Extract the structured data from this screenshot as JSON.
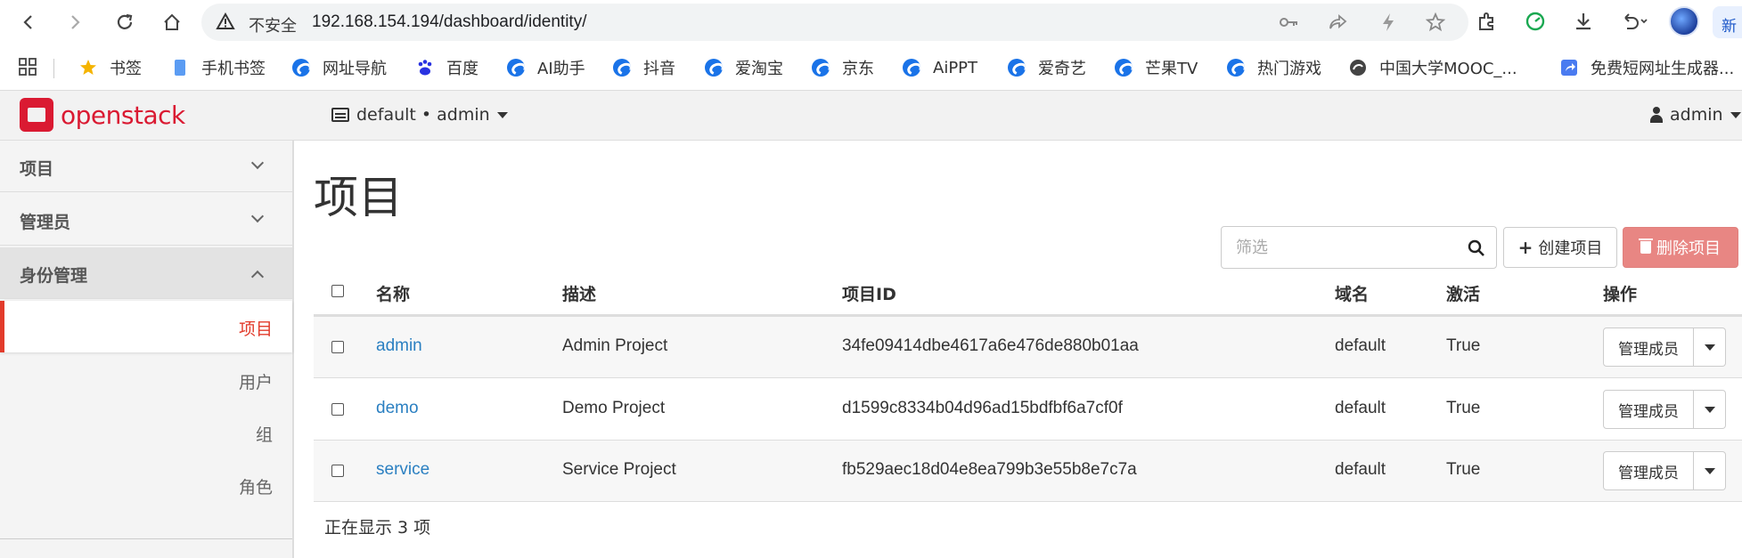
{
  "browser": {
    "insecure_label": "不安全",
    "url": "192.168.154.194/dashboard/identity/",
    "new_label": "新"
  },
  "bookmarks": [
    {
      "label": "书签",
      "icon": "star-icon"
    },
    {
      "label": "手机书签",
      "icon": "phone-icon"
    },
    {
      "label": "网址导航",
      "icon": "edge-icon"
    },
    {
      "label": "百度",
      "icon": "baidu-paw-icon"
    },
    {
      "label": "AI助手",
      "icon": "edge-icon"
    },
    {
      "label": "抖音",
      "icon": "edge-icon"
    },
    {
      "label": "爱淘宝",
      "icon": "edge-icon"
    },
    {
      "label": "京东",
      "icon": "edge-icon"
    },
    {
      "label": "AiPPT",
      "icon": "edge-icon"
    },
    {
      "label": "爱奇艺",
      "icon": "edge-icon"
    },
    {
      "label": "芒果TV",
      "icon": "edge-icon"
    },
    {
      "label": "热门游戏",
      "icon": "edge-icon"
    },
    {
      "label": "中国大学MOOC_...",
      "icon": "mooc-icon"
    },
    {
      "label": "免费短网址生成器...",
      "icon": "share-link-icon"
    }
  ],
  "header": {
    "logo_text": "openstack",
    "context": "default • admin",
    "user": "admin",
    "brand_color": "#da1a32"
  },
  "sidebar": {
    "sections": [
      {
        "label": "项目",
        "expanded": false
      },
      {
        "label": "管理员",
        "expanded": false
      },
      {
        "label": "身份管理",
        "expanded": true
      }
    ],
    "items": [
      {
        "label": "项目",
        "active": true
      },
      {
        "label": "用户",
        "active": false
      },
      {
        "label": "组",
        "active": false
      },
      {
        "label": "角色",
        "active": false
      }
    ]
  },
  "main": {
    "title": "项目",
    "filter_placeholder": "筛选",
    "create_label": "创建项目",
    "delete_label": "删除项目",
    "columns": [
      "名称",
      "描述",
      "项目ID",
      "域名",
      "激活",
      "操作"
    ],
    "rows": [
      {
        "name": "admin",
        "description": "Admin Project",
        "id": "34fe09414dbe4617a6e476de880b01aa",
        "domain": "default",
        "enabled": "True",
        "action": "管理成员"
      },
      {
        "name": "demo",
        "description": "Demo Project",
        "id": "d1599c8334b04d96ad15bdfbf6a7cf0f",
        "domain": "default",
        "enabled": "True",
        "action": "管理成员"
      },
      {
        "name": "service",
        "description": "Service Project",
        "id": "fb529aec18d04e8ea799b3e55b8e7c7a",
        "domain": "default",
        "enabled": "True",
        "action": "管理成员"
      }
    ],
    "footer": "正在显示 3 项"
  }
}
